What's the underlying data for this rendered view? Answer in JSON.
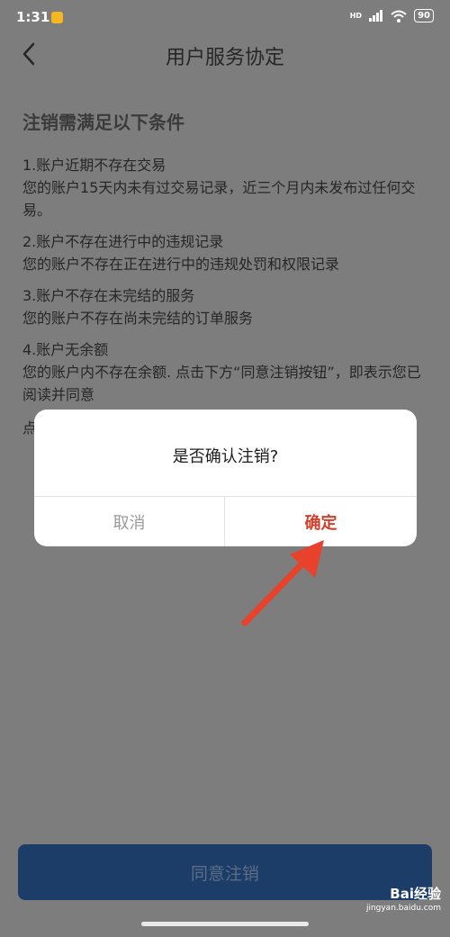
{
  "status_bar": {
    "time": "1:31",
    "hd_label": "HD",
    "battery": "90"
  },
  "nav": {
    "title": "用户服务协定"
  },
  "content": {
    "title": "注销需满足以下条件",
    "conditions": [
      {
        "heading": "1.账户近期不存在交易",
        "desc": "您的账户15天内未有过交易记录，近三个月内未发布过任何交易。"
      },
      {
        "heading": "2.账户不存在进行中的违规记录",
        "desc": "您的账户不存在正在进行中的违规处罚和权限记录"
      },
      {
        "heading": "3.账户不存在未完结的服务",
        "desc": "您的账户不存在尚未完结的订单服务"
      },
      {
        "heading": "4.账户无余额",
        "desc": "您的账户内不存在余额. 点击下方“同意注销按钮”，即表示您已阅读并同意"
      }
    ],
    "partial_text": "点"
  },
  "dialog": {
    "message": "是否确认注销?",
    "cancel_label": "取消",
    "confirm_label": "确定"
  },
  "footer": {
    "agree_label": "同意注销"
  },
  "watermark": {
    "brand": "Bai经验",
    "url": "jingyan.baidu.com"
  },
  "colors": {
    "accent_red": "#d0402c",
    "button_blue": "#1c3d68",
    "arrow_red": "#e8412c"
  }
}
